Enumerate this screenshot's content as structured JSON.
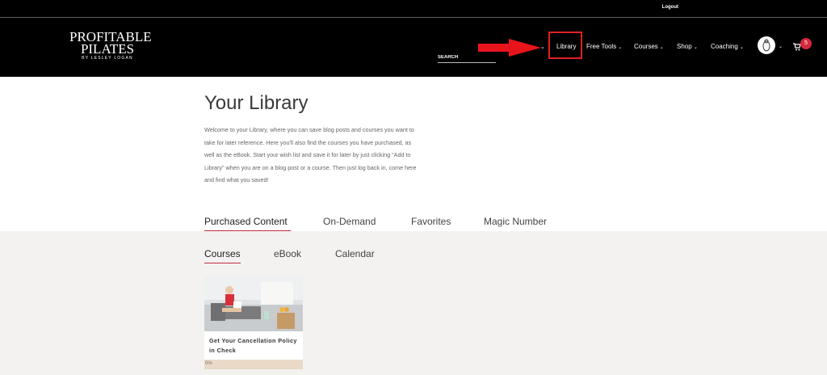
{
  "topbar": {
    "logout": "Logout"
  },
  "logo": {
    "line1": "PROFITABLE",
    "line2": "PILATES",
    "line3": "BY LESLEY LOGAN"
  },
  "search": {
    "placeholder": "SEARCH"
  },
  "nav": {
    "library": "Library",
    "free_tools": "Free Tools",
    "courses": "Courses",
    "shop": "Shop",
    "coaching": "Coaching"
  },
  "cart": {
    "count": "5"
  },
  "page": {
    "title": "Your Library",
    "intro": "Welcome to your Library, where you can save blog posts and courses you want to take for later reference. Here you'll also find the courses you have purchased, as well as the eBook. Start your wish list and save it for later by just clicking \"Add to Library\" when you are on a blog post or a course. Then just log back in, come here and find what you saved!"
  },
  "tabs": [
    "Purchased Content",
    "On-Demand",
    "Favorites",
    "Magic Number"
  ],
  "subtabs": [
    "Courses",
    "eBook",
    "Calendar"
  ],
  "card": {
    "title": "Get Your Cancellation Policy in Check",
    "progress": "0%"
  },
  "colors": {
    "accent": "#c0303e",
    "header_bg": "#000000",
    "panel_bg": "#f4f2f0",
    "callout_red": "#e02020"
  },
  "icons": [
    "arrow-right-icon",
    "chevron-down-icon",
    "avatar-icon",
    "cart-icon"
  ]
}
